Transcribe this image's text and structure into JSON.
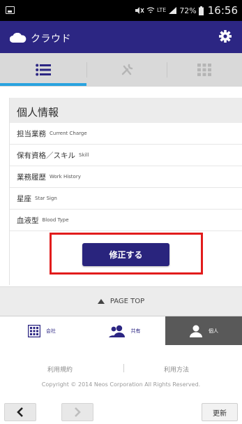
{
  "status_bar": {
    "time": "16:56",
    "battery": "72%",
    "network": "LTE"
  },
  "app_bar": {
    "title": "クラウド"
  },
  "tabs": [
    "list",
    "tools",
    "grid"
  ],
  "profile": {
    "section_title": "個人情報",
    "fields": [
      {
        "label_jp": "担当業務",
        "label_en": "Current Charge"
      },
      {
        "label_jp": "保有資格／スキル",
        "label_en": "Skill"
      },
      {
        "label_jp": "業務履歴",
        "label_en": "Work History"
      },
      {
        "label_jp": "星座",
        "label_en": "Star Sign"
      },
      {
        "label_jp": "血液型",
        "label_en": "Blood Type"
      }
    ],
    "edit_button": "修正する"
  },
  "page_top": "PAGE TOP",
  "bottom_nav": {
    "items": [
      {
        "label": "会社",
        "icon": "building-icon"
      },
      {
        "label": "共有",
        "icon": "users-icon"
      },
      {
        "label": "個人",
        "icon": "person-icon",
        "active": true
      }
    ]
  },
  "footer": {
    "terms": "利用規約",
    "usage": "利用方法",
    "copyright": "Copyright © 2014 Neos Corporation All Rights Reserved."
  },
  "toolbar": {
    "refresh": "更新"
  },
  "colors": {
    "primary": "#2c2683",
    "accent": "#29a3df",
    "highlight": "#e21c1c",
    "active_nav": "#595959"
  }
}
